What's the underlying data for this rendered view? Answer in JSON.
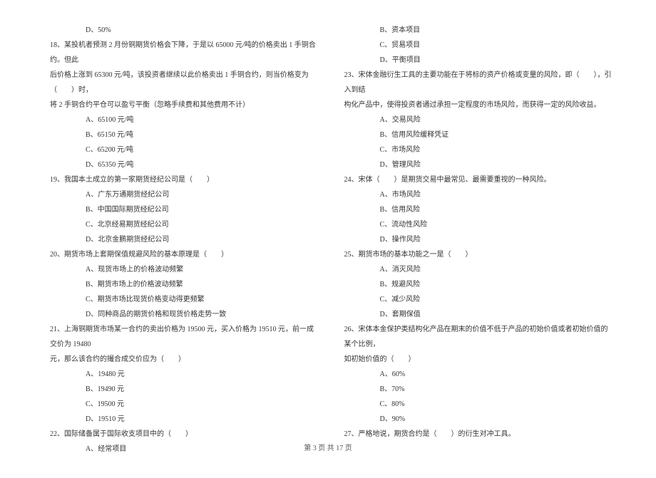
{
  "left": {
    "opt17d": "D、50%",
    "q18_1": "18、某投机者预测 2 月份铜期货价格会下降，于是以 65000 元/吨的价格卖出 1 手铜合约。但此",
    "q18_2": "后价格上涨到 65300 元/吨，该投资者继续以此价格卖出 1 手铜合约，则当价格变为（　　）时，",
    "q18_3": "将 2 手铜合约平仓可以盈亏平衡（忽略手续费和其他费用不计）",
    "q18a": "A、65100 元/吨",
    "q18b": "B、65150 元/吨",
    "q18c": "C、65200 元/吨",
    "q18d": "D、65350 元/吨",
    "q19": "19、我国本土成立的第一家期货经纪公司是（　　）",
    "q19a": "A、广东万通期货经纪公司",
    "q19b": "B、中国国际期货经纪公司",
    "q19c": "C、北京经易期货经纪公司",
    "q19d": "D、北京金鹏期货经纪公司",
    "q20": "20、期货市场上套期保值规避风险的基本原理是（　　）",
    "q20a": "A、现货市场上的价格波动频繁",
    "q20b": "B、期货市场上的价格波动频繁",
    "q20c": "C、期货市场比现货价格变动得更频繁",
    "q20d": "D、同种商品的期货价格和现货价格走势一致",
    "q21_1": "21、上海铜期货市场某一合约的卖出价格为 19500 元，买入价格为 19510 元，前一成交价为 19480",
    "q21_2": "元，那么该合约的撮合成交价应为（　　）",
    "q21a": "A、19480 元",
    "q21b": "B、19490 元",
    "q21c": "C、19500 元",
    "q21d": "D、19510 元",
    "q22": "22、国际储备属于国际收支项目中的（　　）",
    "q22a": "A、经常项目"
  },
  "right": {
    "q22b": "B、资本项目",
    "q22c": "C、贸易项目",
    "q22d": "D、平衡项目",
    "q23_1": "23、宋体金融衍生工具的主要功能在于将标的资产价格或变量的风险，即（　　），引入到结",
    "q23_2": "构化产品中，使得投资者通过承担一定程度的市场风险，而获得一定的风险收益。",
    "q23a": "A、交易风险",
    "q23b": "B、信用风险缓释凭证",
    "q23c": "C、市场风险",
    "q23d": "D、管理风险",
    "q24": "24、宋体（　　）是期货交易中最常见、最需要重视的一种风险。",
    "q24a": "A、市场风险",
    "q24b": "B、信用风险",
    "q24c": "C、流动性风险",
    "q24d": "D、操作风险",
    "q25": "25、期货市场的基本功能之一是（　　）",
    "q25a": "A、消灭风险",
    "q25b": "B、规避风险",
    "q25c": "C、减少风险",
    "q25d": "D、套期保值",
    "q26_1": "26、宋体本金保护类结构化产品在期末的价值不低于产品的初始价值或者初始价值的某个比例，",
    "q26_2": "如初始价值的（　　）",
    "q26a": "A、60%",
    "q26b": "B、70%",
    "q26c": "C、80%",
    "q26d": "D、90%",
    "q27": "27、严格地说，期货合约是（　　）的衍生对冲工具。"
  },
  "footer": "第 3 页 共 17 页"
}
